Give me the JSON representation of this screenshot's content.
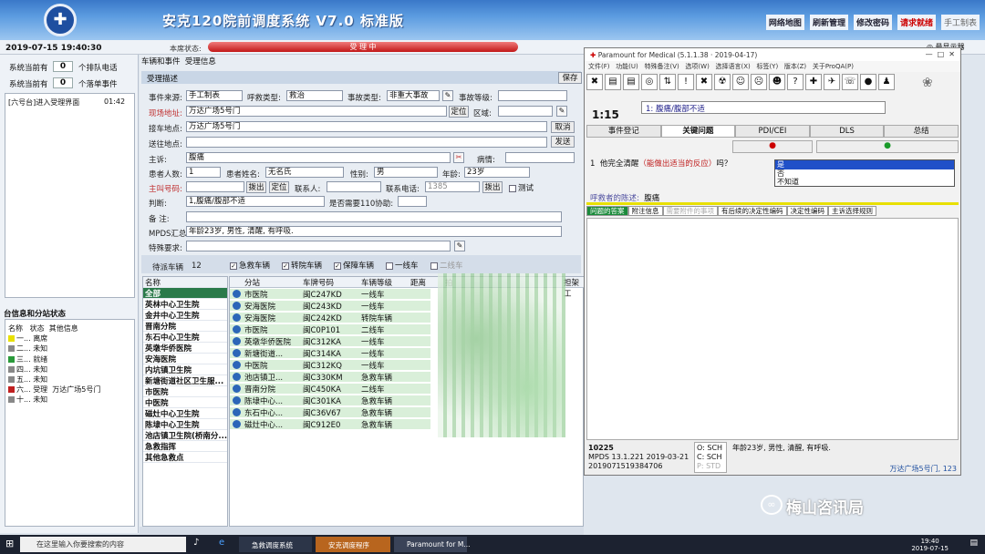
{
  "app": {
    "title": "安克120院前调度系统 V7.0 标准版",
    "logo_glyph": "✚"
  },
  "top_links": [
    "网络地图",
    "刷新管理",
    "修改密码",
    "请求就绪",
    "手工制表"
  ],
  "status": {
    "datetime": "2019-07-15  19:40:30",
    "state_label": "本席状态:",
    "state_value": "受  理  中",
    "right_text": "◎ 最显示器"
  },
  "left": {
    "counts": [
      {
        "label": "系统当前有",
        "value": "0",
        "suffix": "个排队电话"
      },
      {
        "label": "系统当前有",
        "value": "0",
        "suffix": "个落单事件"
      }
    ],
    "log": [
      {
        "text": "[六号台]进入受理界面",
        "time": "01:42"
      }
    ],
    "seat_title": "台信息和分站状态",
    "seat_headers": [
      "名称",
      "状态",
      "其他信息"
    ],
    "seats": [
      {
        "name": "一...",
        "state": "离席",
        "info": "",
        "color": "#e8e000"
      },
      {
        "name": "二...",
        "state": "未知",
        "info": "",
        "color": "#888888"
      },
      {
        "name": "三...",
        "state": "就绪",
        "info": "",
        "color": "#2a9a3a"
      },
      {
        "name": "四...",
        "state": "未知",
        "info": "",
        "color": "#888888"
      },
      {
        "name": "五...",
        "state": "未知",
        "info": "",
        "color": "#888888"
      },
      {
        "name": "六...",
        "state": "受理",
        "info": "万达广场5号门",
        "color": "#c02020"
      },
      {
        "name": "十...",
        "state": "未知",
        "info": "",
        "color": "#888888"
      }
    ]
  },
  "form": {
    "tabs": [
      "车辆和事件",
      "受理信息"
    ],
    "section": "受理描述",
    "save_btn": "保存",
    "source_lbl": "事件来源:",
    "source_val": "手工制表",
    "calltype_lbl": "呼救类型:",
    "calltype_val": "救治",
    "eventtype_lbl": "事故类型:",
    "eventtype_val": "非重大事故",
    "level_lbl": "事故等级:",
    "level_val": "",
    "site_lbl": "现场地址:",
    "site_val": "万达广场5号门",
    "locate_btn": "定位",
    "area_lbl": "区域:",
    "pickup_lbl": "接车地点:",
    "pickup_val": "万达广场5号门",
    "cancel_btn": "取消",
    "dest_lbl": "送往地点:",
    "send_btn": "发送",
    "complaint_lbl": "主诉:",
    "complaint_val": "腹痛",
    "illness_lbl": "病情:",
    "patients_lbl": "患者人数:",
    "patients_val": "1",
    "name_lbl": "患者姓名:",
    "name_val": "无名氏",
    "sex_lbl": "性别:",
    "sex_val": "男",
    "age_lbl": "年龄:",
    "age_val": "23岁",
    "caller_lbl": "主叫号码:",
    "caller_val": "",
    "dial_btn": "拨出",
    "locate2_btn": "定位",
    "contact_lbl": "联系人:",
    "phone_lbl": "联系电话:",
    "phone_val": "1385",
    "dial2_btn": "拨出",
    "test_lbl": "测试",
    "judge_lbl": "判断:",
    "judge_val": "1,腹痛/腹部不适",
    "assist_lbl": "是否需要110协助:",
    "note_lbl": "备    注:",
    "mpds_lbl": "MPDS汇总:",
    "mpds_val": "年龄23岁, 男性, 清醒, 有呼吸.",
    "special_lbl": "特殊要求:"
  },
  "vehicles": {
    "title": "待派车辆",
    "count": "12",
    "filters": [
      {
        "label": "急救车辆",
        "checked": true
      },
      {
        "label": "转院车辆",
        "checked": true
      },
      {
        "label": "保障车辆",
        "checked": true
      },
      {
        "label": "一线车",
        "checked": false
      },
      {
        "label": "二线车",
        "checked": false
      }
    ],
    "station_header": "名称",
    "stations": [
      "全部",
      "英林中心卫生院",
      "金井中心卫生院",
      "晋南分院",
      "东石中心卫生院",
      "英墩华侨医院",
      "安海医院",
      "内坑镇卫生院",
      "新塘街道社区卫生服...",
      "市医院",
      "中医院",
      "磁灶中心卫生院",
      "陈埭中心卫生院",
      "池店镇卫生院(桥南分...",
      "急救指挥",
      "其他急救点"
    ],
    "headers": [
      "分站",
      "车牌号码",
      "车辆等级",
      "距离",
      "拍",
      "担架工"
    ],
    "rows": [
      {
        "station": "市医院",
        "plate": "闽C247KD",
        "level": "一线车"
      },
      {
        "station": "安海医院",
        "plate": "闽C243KD",
        "level": "一线车"
      },
      {
        "station": "安海医院",
        "plate": "闽C242KD",
        "level": "转院车辆"
      },
      {
        "station": "市医院",
        "plate": "闽C0P101",
        "level": "二线车"
      },
      {
        "station": "英墩华侨医院",
        "plate": "闽C312KA",
        "level": "一线车"
      },
      {
        "station": "新塘街道...",
        "plate": "闽C314KA",
        "level": "一线车"
      },
      {
        "station": "中医院",
        "plate": "闽C312KQ",
        "level": "一线车"
      },
      {
        "station": "池店镇卫...",
        "plate": "闽C330KM",
        "level": "急救车辆"
      },
      {
        "station": "晋南分院",
        "plate": "闽C450KA",
        "level": "二线车"
      },
      {
        "station": "陈埭中心...",
        "plate": "闽C301KA",
        "level": "急救车辆"
      },
      {
        "station": "东石中心...",
        "plate": "闽C36V67",
        "level": "急救车辆"
      },
      {
        "station": "磁灶中心...",
        "plate": "闽C912E0",
        "level": "急救车辆"
      }
    ]
  },
  "paramount": {
    "title": "Paramount for Medical (5.1.1.38 · 2019-04-17)",
    "menu": [
      "文件(F)",
      "功能(U)",
      "特殊备注(V)",
      "选项(W)",
      "选择语言(X)",
      "标签(Y)",
      "版本(Z)",
      "关于ProQA(P)"
    ],
    "toolbar": [
      "✖",
      "▤",
      "▤",
      "◎",
      "⇅",
      "!",
      "✖",
      "☢",
      "☺",
      "☹",
      "☻",
      "?",
      "✚",
      "✈",
      "☏",
      "●",
      "♟"
    ],
    "elapsed": "1:15",
    "complaint": "1: 腹痛/腹部不适",
    "tabs": [
      "事件登记",
      "关键问题",
      "PDI/CEI",
      "DLS",
      "总结"
    ],
    "question_num": "1",
    "question_pre": "他完全清醒",
    "question_red": "（能做出适当的反应）",
    "question_post": "吗？",
    "answers": [
      "是",
      "否",
      "不知道"
    ],
    "reporter_lbl": "呼救者的陈述:",
    "reporter_val": "腹痛",
    "subtabs": [
      "问题的答案",
      "附注信息",
      "需要附件的事项",
      "有后续的决定性编码",
      "决定性编码",
      "主诉选择规则"
    ],
    "footer": {
      "case": "10225",
      "mpds": "MPDS  13.1.221  2019-03-21",
      "id": "2019071519384706",
      "codes": [
        "O: SCH",
        "C: SCH",
        "P: STD"
      ],
      "summary": "年龄23岁, 男性, 清醒, 有呼吸.",
      "location": "万达广场5号门, 123"
    }
  },
  "watermark": "梅山咨讯局",
  "taskbar": {
    "search": "在这里输入你要搜索的内容",
    "items": [
      "急救调度系统",
      "安克调度程序",
      "Paramount for M..."
    ],
    "time": "19:40",
    "date": "2019-07-15"
  }
}
